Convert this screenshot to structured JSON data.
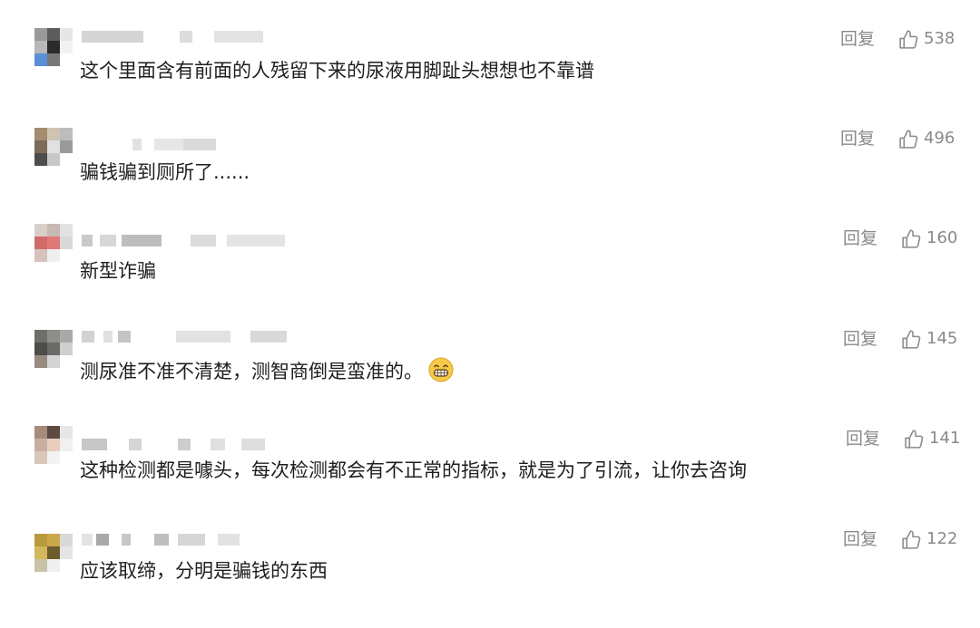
{
  "reply_label": "回复",
  "like_icon": "thumbs-up-icon",
  "comments": [
    {
      "text": "这个里面含有前面的人残留下来的尿液用脚趾头想想也不靠谱",
      "likes": "538"
    },
    {
      "text": "骗钱骗到厕所了......",
      "likes": "496"
    },
    {
      "text": "新型诈骗",
      "likes": "160"
    },
    {
      "text": "测尿准不准不清楚，测智商倒是蛮准的。",
      "likes": "145",
      "emoji": "grinning-face-emoji"
    },
    {
      "text": "这种检测都是噱头，每次检测都会有不正常的指标，就是为了引流，让你去咨询",
      "likes": "141"
    },
    {
      "text": "应该取缔，分明是骗钱的东西",
      "likes": "122"
    }
  ]
}
